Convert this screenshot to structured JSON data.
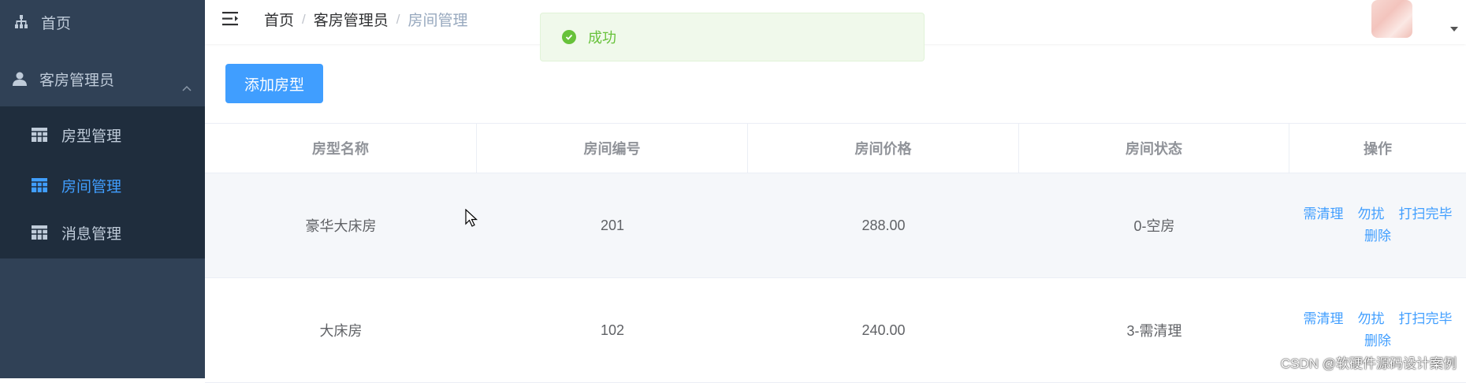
{
  "sidebar": {
    "home_label": "首页",
    "group_label": "客房管理员",
    "items": [
      {
        "label": "房型管理"
      },
      {
        "label": "房间管理"
      },
      {
        "label": "消息管理"
      }
    ]
  },
  "header": {
    "breadcrumb": [
      "首页",
      "客房管理员",
      "房间管理"
    ]
  },
  "toast": {
    "message": "成功"
  },
  "toolbar": {
    "add_label": "添加房型"
  },
  "table": {
    "columns": [
      "房型名称",
      "房间编号",
      "房间价格",
      "房间状态",
      "操作"
    ],
    "rows": [
      {
        "type": "豪华大床房",
        "number": "201",
        "price": "288.00",
        "status": "0-空房"
      },
      {
        "type": "大床房",
        "number": "102",
        "price": "240.00",
        "status": "3-需清理"
      }
    ],
    "actions": [
      "需清理",
      "勿扰",
      "打扫完毕",
      "删除"
    ]
  },
  "watermark": "CSDN @软硬件源码设计案例",
  "colors": {
    "sidebar": "#304156",
    "submenu": "#1f2d3d",
    "accent": "#409eff",
    "success": "#67c23a"
  }
}
